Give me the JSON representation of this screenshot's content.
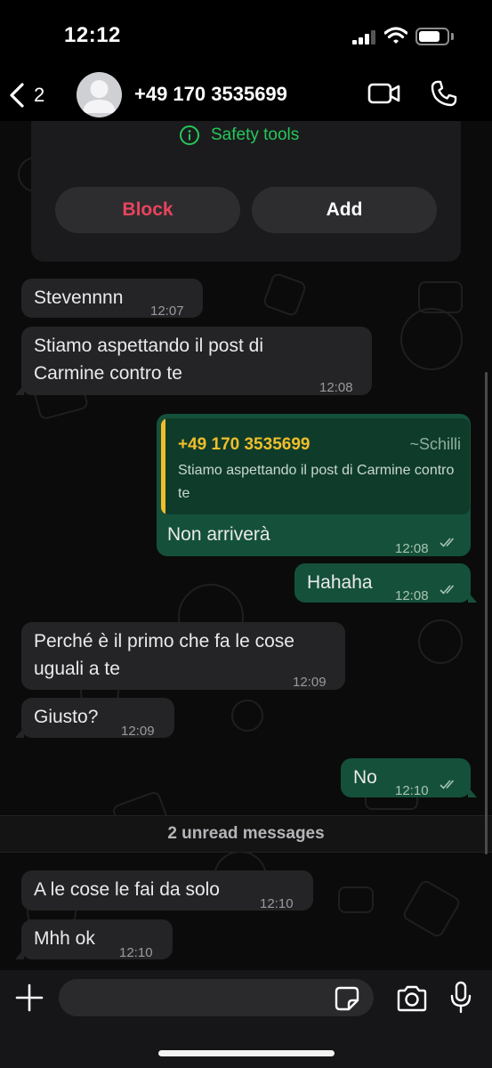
{
  "status_bar": {
    "time": "12:12"
  },
  "header": {
    "back_count": "2",
    "contact_name": "+49 170 3535699",
    "icons": {
      "back": "chevron-left-icon",
      "avatar": "person-avatar-icon",
      "video": "video-camera-icon",
      "call": "phone-icon"
    }
  },
  "info_card": {
    "safety_tools_label": "Safety tools",
    "block_label": "Block",
    "add_label": "Add"
  },
  "messages": [
    {
      "direction": "in",
      "text": "Stevennnn",
      "time": "12:07"
    },
    {
      "direction": "in",
      "text_lines": [
        "Stiamo aspettando il post di",
        "Carmine contro te"
      ],
      "time": "12:08"
    },
    {
      "direction": "out",
      "quote": {
        "author": "+49 170 3535699",
        "alias": "~Schilli",
        "text": "Stiamo aspettando il post di Carmine contro te"
      },
      "text": "Non arriverà",
      "time": "12:08",
      "status": "read"
    },
    {
      "direction": "out",
      "text": "Hahaha",
      "time": "12:08",
      "status": "read"
    },
    {
      "direction": "in",
      "text_lines": [
        "Perché è il primo che fa le cose",
        "uguali a te"
      ],
      "time": "12:09"
    },
    {
      "direction": "in",
      "text": "Giusto?",
      "time": "12:09"
    },
    {
      "direction": "out",
      "text": "No",
      "time": "12:10",
      "status": "read"
    },
    {
      "direction": "in",
      "text": "A le cose le fai da solo",
      "time": "12:10"
    },
    {
      "direction": "in",
      "text": "Mhh ok",
      "time": "12:10"
    }
  ],
  "unread_divider": "2 unread messages",
  "composer": {
    "placeholder": "",
    "icons": {
      "attach": "plus-icon",
      "sticker": "sticker-icon",
      "camera": "camera-icon",
      "mic": "microphone-icon"
    }
  },
  "colors": {
    "incoming_bubble": "#242426",
    "outgoing_bubble": "#15513a",
    "accent_green": "#26c65a",
    "block_red": "#e8445c",
    "quote_yellow": "#f1be2c"
  }
}
